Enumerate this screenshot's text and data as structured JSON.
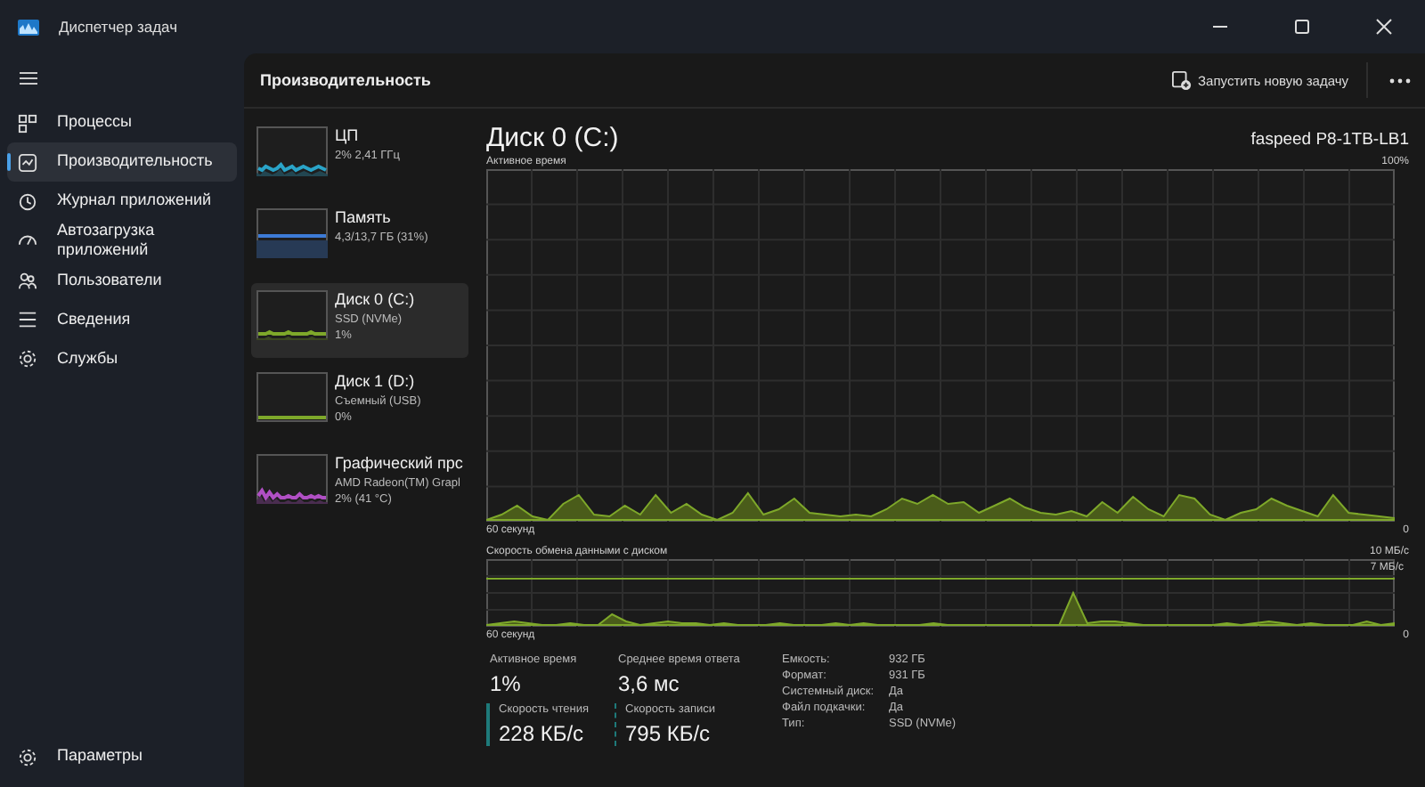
{
  "window": {
    "title": "Диспетчер задач"
  },
  "sidebar": {
    "items": [
      {
        "label": "Процессы",
        "selected": false
      },
      {
        "label": "Производительность",
        "selected": true
      },
      {
        "label": "Журнал приложений",
        "selected": false
      },
      {
        "label": "Автозагрузка приложений",
        "selected": false
      },
      {
        "label": "Пользователи",
        "selected": false
      },
      {
        "label": "Сведения",
        "selected": false
      },
      {
        "label": "Службы",
        "selected": false
      }
    ],
    "footer": "Параметры"
  },
  "header": {
    "title": "Производительность",
    "run_task_button": "Запустить новую задачу"
  },
  "devices": [
    {
      "name": "ЦП",
      "lines": [
        "2% 2,41 ГГц"
      ],
      "selected": false,
      "color": "#2aa4c8"
    },
    {
      "name": "Память",
      "lines": [
        "4,3/13,7 ГБ (31%)"
      ],
      "selected": false,
      "color": "#3d7bd6"
    },
    {
      "name": "Диск 0 (C:)",
      "lines": [
        "SSD (NVMe)",
        "1%"
      ],
      "selected": true,
      "color": "#7ea82a"
    },
    {
      "name": "Диск 1 (D:)",
      "lines": [
        "Съемный (USB)",
        "0%"
      ],
      "selected": false,
      "color": "#7ea82a"
    },
    {
      "name": "Графический прс",
      "lines": [
        "AMD Radeon(TM) Grapl",
        "2% (41 °C)"
      ],
      "selected": false,
      "color": "#b04fc4"
    }
  ],
  "detail": {
    "title": "Диск 0 (C:)",
    "model": "faspeed P8-1TB-LB1",
    "active_chart": {
      "label": "Активное время",
      "max": "100%",
      "time": "60 секунд",
      "min": "0"
    },
    "transfer_chart": {
      "label": "Скорость обмена данными с диском",
      "max": "10 МБ/с",
      "marker": "7 МБ/с",
      "time": "60 секунд",
      "min": "0"
    },
    "stats": [
      {
        "label": "Активное время",
        "value": "1%",
        "kind": "plain"
      },
      {
        "label": "Среднее время ответа",
        "value": "3,6 мс",
        "kind": "plain"
      },
      {
        "label": "Скорость чтения",
        "value": "228 КБ/с",
        "kind": "read"
      },
      {
        "label": "Скорость записи",
        "value": "795 КБ/с",
        "kind": "write"
      }
    ],
    "properties": [
      {
        "key": "Емкость:",
        "value": "932 ГБ"
      },
      {
        "key": "Формат:",
        "value": "931 ГБ"
      },
      {
        "key": "Системный диск:",
        "value": "Да"
      },
      {
        "key": "Файл подкачки:",
        "value": "Да"
      },
      {
        "key": "Тип:",
        "value": "SSD (NVMe)"
      }
    ]
  }
}
